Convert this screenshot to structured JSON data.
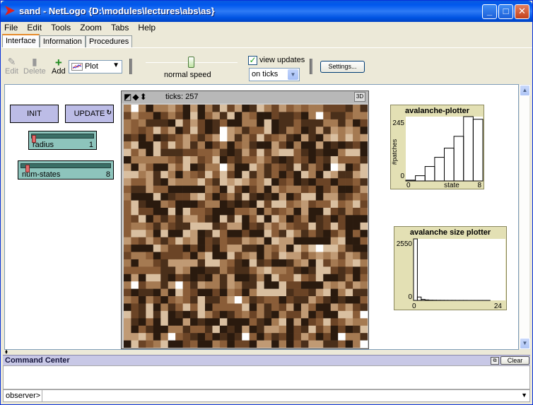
{
  "window": {
    "title": "sand - NetLogo {D:\\modules\\lectures\\abs\\as}",
    "minimize": "_",
    "maximize": "□",
    "close": "✕"
  },
  "menu": [
    "File",
    "Edit",
    "Tools",
    "Zoom",
    "Tabs",
    "Help"
  ],
  "tabs": [
    "Interface",
    "Information",
    "Procedures"
  ],
  "toolbar": {
    "edit": "Edit",
    "delete": "Delete",
    "add": "Add",
    "widget_type": "Plot",
    "speed_label": "normal speed",
    "speed_level": 0.5,
    "view_updates": "view updates",
    "view_updates_checked": true,
    "update_mode": "on ticks",
    "settings": "Settings..."
  },
  "buttons": {
    "init": "INIT",
    "update": "UPDATE"
  },
  "sliders": [
    {
      "name": "radius",
      "value": "1",
      "fraction": 0.0
    },
    {
      "name": "num-states",
      "value": "8",
      "fraction": 0.05
    }
  ],
  "view": {
    "ticks": "ticks: 257",
    "three_d": "3D",
    "grid_size": 33
  },
  "plots": [
    {
      "title": "avalanche-plotter",
      "ylabel": "#patches",
      "xlabel": "state",
      "xmin": "0",
      "xmax": "8",
      "ymin": "0",
      "ymax": "245",
      "bars": [
        3,
        20,
        55,
        90,
        125,
        170,
        245,
        235
      ]
    },
    {
      "title": "avalanche size plotter",
      "ylabel": "",
      "xlabel": "",
      "xmin": "0",
      "xmax": "24",
      "ymin": "0",
      "ymax": "2550",
      "bars": [
        2550,
        140,
        40,
        20,
        10,
        8,
        6,
        5,
        4,
        3,
        3,
        2,
        2,
        2,
        1,
        1,
        1,
        1,
        1,
        1,
        0,
        0,
        0,
        0
      ]
    }
  ],
  "command_center": {
    "title": "Command Center",
    "clear": "Clear",
    "prompt": "observer>",
    "input_value": ""
  },
  "colors": {
    "button_bg": "#bcbce6",
    "slider_bg": "#8dc4bc",
    "plot_bg": "#e3e0b4",
    "title_blue": "#0054e3"
  }
}
